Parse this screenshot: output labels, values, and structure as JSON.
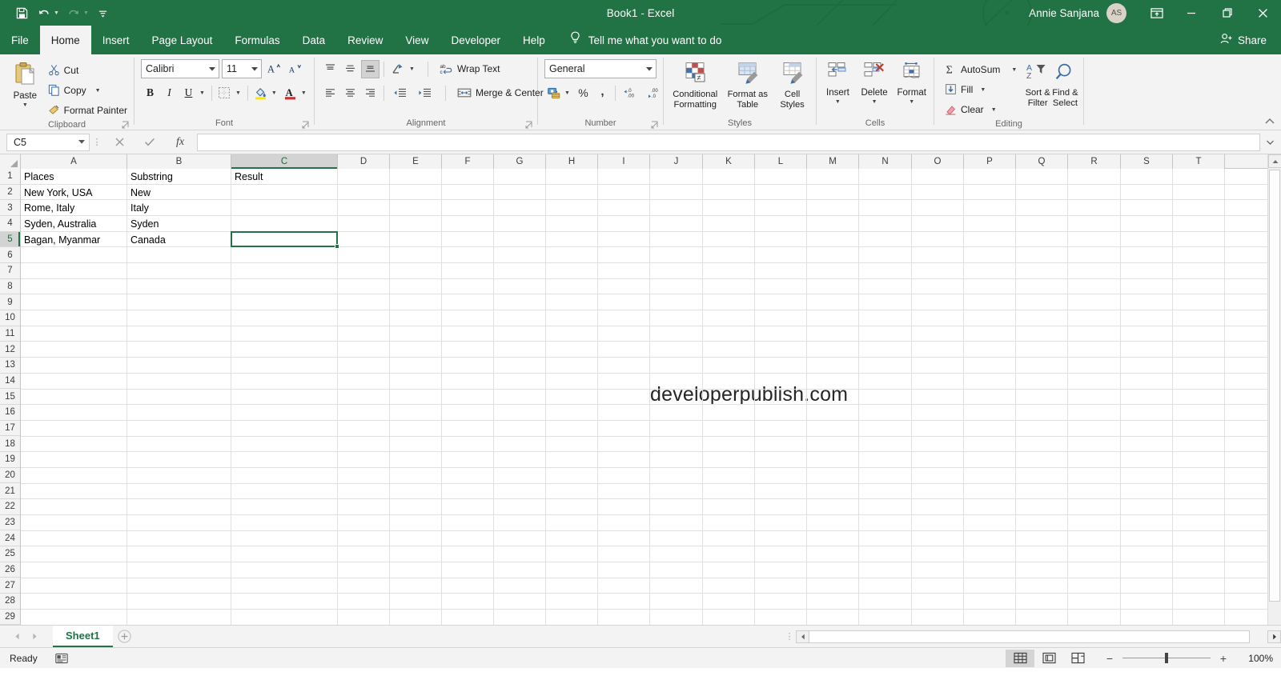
{
  "titlebar": {
    "document_title": "Book1  -  Excel",
    "account_name": "Annie Sanjana",
    "account_initials": "AS",
    "quick_access": [
      {
        "name": "save-icon",
        "label": "Save"
      },
      {
        "name": "undo-icon",
        "label": "Undo"
      },
      {
        "name": "redo-icon",
        "label": "Redo"
      },
      {
        "name": "customize-qat-icon",
        "label": "Customize Quick Access Toolbar"
      }
    ],
    "window_controls": [
      {
        "name": "ribbon-display-options-icon",
        "label": "Ribbon Display Options"
      },
      {
        "name": "minimize-icon",
        "label": "Minimize"
      },
      {
        "name": "restore-icon",
        "label": "Restore Down"
      },
      {
        "name": "close-icon",
        "label": "Close"
      }
    ],
    "accent_color": "#217346"
  },
  "tabs": [
    {
      "label": "File",
      "active": false
    },
    {
      "label": "Home",
      "active": true
    },
    {
      "label": "Insert",
      "active": false
    },
    {
      "label": "Page Layout",
      "active": false
    },
    {
      "label": "Formulas",
      "active": false
    },
    {
      "label": "Data",
      "active": false
    },
    {
      "label": "Review",
      "active": false
    },
    {
      "label": "View",
      "active": false
    },
    {
      "label": "Developer",
      "active": false
    },
    {
      "label": "Help",
      "active": false
    }
  ],
  "tellme": {
    "text": "Tell me what you want to do"
  },
  "share": {
    "label": "Share"
  },
  "ribbon": {
    "clipboard": {
      "group_label": "Clipboard",
      "paste_label": "Paste",
      "cut_label": "Cut",
      "copy_label": "Copy",
      "format_painter_label": "Format Painter"
    },
    "font": {
      "group_label": "Font",
      "font_family": "Calibri",
      "font_size": "11",
      "buttons": [
        "Increase Font Size",
        "Decrease Font Size",
        "Bold",
        "Italic",
        "Underline",
        "Borders",
        "Fill Color",
        "Font Color"
      ],
      "bold_label": "B",
      "italic_label": "I",
      "underline_label": "U",
      "font_color_label": "A"
    },
    "alignment": {
      "group_label": "Alignment",
      "wrap_text_label": "Wrap Text",
      "merge_center_label": "Merge & Center",
      "buttons": [
        "Top Align",
        "Middle Align",
        "Bottom Align",
        "Orientation",
        "Align Left",
        "Center",
        "Align Right",
        "Decrease Indent",
        "Increase Indent"
      ]
    },
    "number": {
      "group_label": "Number",
      "format": "General",
      "buttons": [
        "Accounting Number Format",
        "Percent Style",
        "Comma Style",
        "Increase Decimal",
        "Decrease Decimal"
      ]
    },
    "styles": {
      "group_label": "Styles",
      "conditional_formatting_label": "Conditional\nFormatting",
      "conditional_formatting_line1": "Conditional",
      "conditional_formatting_line2": "Formatting",
      "format_as_table_line1": "Format as",
      "format_as_table_line2": "Table",
      "cell_styles_line1": "Cell",
      "cell_styles_line2": "Styles"
    },
    "cells": {
      "group_label": "Cells",
      "insert_label": "Insert",
      "delete_label": "Delete",
      "format_label": "Format"
    },
    "editing": {
      "group_label": "Editing",
      "autosum_label": "AutoSum",
      "fill_label": "Fill",
      "clear_label": "Clear",
      "sort_filter_line1": "Sort &",
      "sort_filter_line2": "Filter",
      "find_select_line1": "Find &",
      "find_select_line2": "Select"
    }
  },
  "formula_bar": {
    "name_box": "C5",
    "formula_value": "",
    "cancel_label": "Cancel",
    "enter_label": "Enter",
    "fx_label": "fx"
  },
  "grid": {
    "columns": [
      "A",
      "B",
      "C",
      "D",
      "E",
      "F",
      "G",
      "H",
      "I",
      "J",
      "K",
      "L",
      "M",
      "N",
      "O",
      "P",
      "Q",
      "R",
      "S",
      "T"
    ],
    "selected_column": "C",
    "selected_row": 5,
    "selected_cell": "C5",
    "rows": [
      1,
      2,
      3,
      4,
      5,
      6,
      7,
      8,
      9,
      10,
      11,
      12,
      13,
      14,
      15,
      16,
      17,
      18,
      19,
      20,
      21,
      22,
      23,
      24,
      25,
      26,
      27,
      28,
      29
    ],
    "headers": {
      "a": "Places",
      "b": "Substring",
      "c": "Result"
    },
    "data": [
      {
        "row": 1,
        "a": "Places",
        "b": "Substring",
        "c": "Result"
      },
      {
        "row": 2,
        "a": "New York, USA",
        "b": "New",
        "c": ""
      },
      {
        "row": 3,
        "a": "Rome, Italy",
        "b": "Italy",
        "c": ""
      },
      {
        "row": 4,
        "a": "Syden, Australia",
        "b": "Syden",
        "c": ""
      },
      {
        "row": 5,
        "a": "Bagan, Myanmar",
        "b": "Canada",
        "c": ""
      }
    ],
    "watermark": "developerpublish.com",
    "selection_color": "#217346"
  },
  "sheetbar": {
    "sheets": [
      {
        "label": "Sheet1",
        "active": true
      }
    ],
    "add_sheet_label": "New sheet"
  },
  "statusbar": {
    "status": "Ready",
    "accessibility_label": "Accessibility Checker",
    "views": [
      {
        "name": "normal-view-icon",
        "label": "Normal",
        "active": true
      },
      {
        "name": "page-layout-view-icon",
        "label": "Page Layout",
        "active": false
      },
      {
        "name": "page-break-preview-icon",
        "label": "Page Break Preview",
        "active": false
      }
    ],
    "zoom_out_label": "−",
    "zoom_in_label": "+",
    "zoom_level": "100%"
  }
}
